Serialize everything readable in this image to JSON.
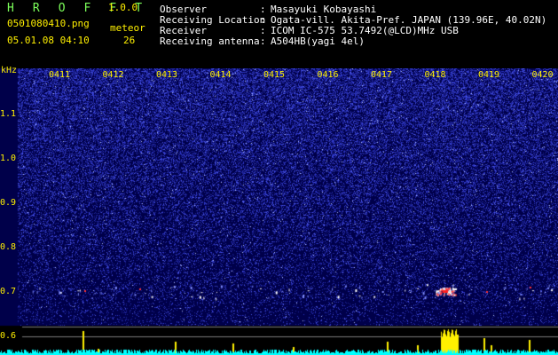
{
  "header": {
    "logo": "H R O F F T",
    "version": "1.0.0",
    "filename": "0501080410.png",
    "meteor_label": "meteor",
    "meteor_count": "26",
    "datetime": "05.01.08 04:10",
    "observer_label": "Observer",
    "observer_value": "Masayuki Kobayashi",
    "location_label": "Receiving Location",
    "location_value": "Ogata-vill. Akita-Pref. JAPAN (139.96E, 40.02N)",
    "receiver_label": "Receiver",
    "receiver_value": "ICOM IC-575 53.7492(@LCD)MHz USB",
    "antenna_label": "Receiving antenna",
    "antenna_value": "A504HB(yagi 4el)",
    "separator": ":"
  },
  "spectrogram": {
    "y_unit": "kHz",
    "y_ticks": [
      "1.1",
      "1.0",
      "0.9",
      "0.8",
      "0.7",
      "0.6"
    ],
    "x_ticks": [
      "0411",
      "0412",
      "0413",
      "0414",
      "0415",
      "0416",
      "0417",
      "0418",
      "0419",
      "0420"
    ]
  },
  "colors": {
    "background": "#000000",
    "header_text": "#FFFFFF",
    "logo": "#7CFF5A",
    "labels": "#FFF000",
    "spectrum_bg": "#00004A",
    "noise": "#2E37C8",
    "trace": "#00FFFF"
  }
}
